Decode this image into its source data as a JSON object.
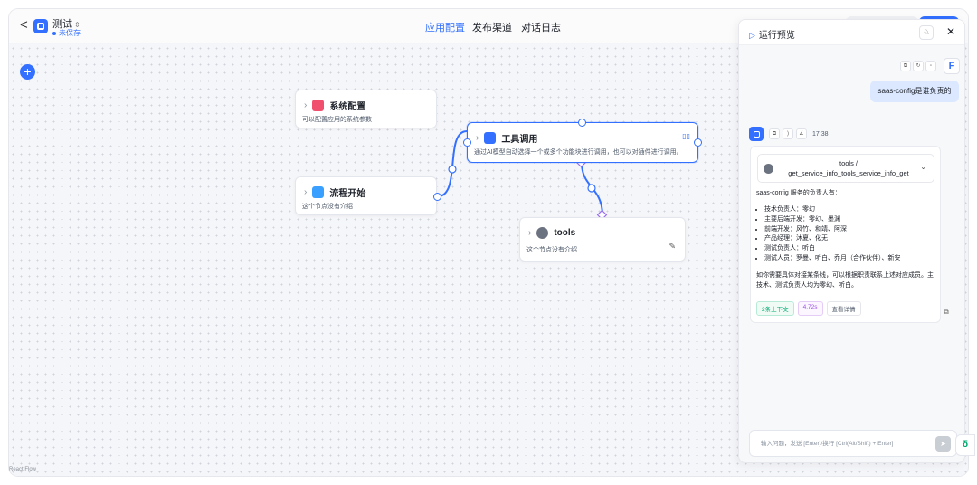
{
  "header": {
    "back_label": "<",
    "app_name": "测试",
    "switch_icon": "⇕",
    "status": "未保存",
    "tabs": [
      "应用配置",
      "发布渠道",
      "对话日志"
    ]
  },
  "colors": {
    "primary": "#3370ff",
    "selected_edge": "#3370ff",
    "tool_edge": "#9a6ef5"
  },
  "canvas": {
    "add_button": "+",
    "nodes": {
      "system": {
        "title": "系统配置",
        "desc": "可以配置应用的系统参数",
        "icon": "gear-icon",
        "color": "#f0506e"
      },
      "start": {
        "title": "流程开始",
        "desc": "这个节点没有介绍",
        "icon": "play-icon",
        "color": "#3aa0ff"
      },
      "tool_call": {
        "title": "工具调用",
        "desc": "通过AI模型自动选择一个或多个功能块进行调用，也可以对插件进行调用。",
        "icon": "toolbox-icon",
        "color": "#3370ff"
      },
      "tools": {
        "title": "tools",
        "desc": "这个节点没有介绍",
        "icon": "globe-icon",
        "color": "#6b7280"
      }
    },
    "footer_label": "React Flow"
  },
  "preview": {
    "title": "运行预览",
    "user_message": "saas-config是谁负责的",
    "answer_time": "17:38",
    "tool_name": "tools / get_service_info_tools_service_info_get",
    "answer_intro": "saas-config 服务的负责人有：",
    "answer_items": [
      "技术负责人：零幻",
      "主要后端开发：零幻、墨渊",
      "前端开发：风竹、和靖、阿深",
      "产品经理：沐夏、化无",
      "测试负责人：听白",
      "测试人员：罗曼、听白、乔月（合作伙伴）、新安"
    ],
    "answer_tail": "如你需要具体对接某条线，可以根据职责联系上述对应成员。主技术、测试负责人均为零幻、听白。",
    "badges": {
      "context": "2条上下文",
      "duration": "4.72s",
      "detail": "查看详情"
    },
    "input_placeholder": "输入问题，发送 [Enter]/换行 [Ctrl(Alt/Shift) + Enter]"
  }
}
